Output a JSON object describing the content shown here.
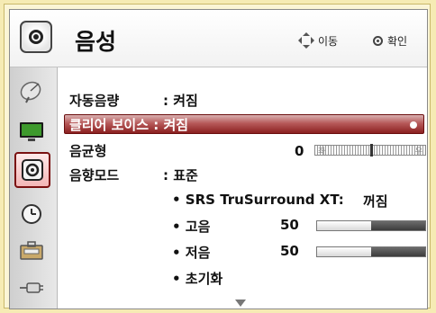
{
  "header": {
    "title": "음성",
    "move_label": "이동",
    "ok_label": "확인"
  },
  "sidebar": {
    "items": [
      {
        "icon": "satellite-dish-icon"
      },
      {
        "icon": "tv-screen-icon"
      },
      {
        "icon": "speaker-icon",
        "active": true
      },
      {
        "icon": "clock-icon"
      },
      {
        "icon": "toolbox-icon"
      },
      {
        "icon": "cable-plug-icon"
      }
    ]
  },
  "menu": {
    "auto_volume": {
      "label": "자동음량",
      "value": ": 켜짐"
    },
    "clear_voice": {
      "label": "클리어 보이스 : 켜짐"
    },
    "balance": {
      "label": "음균형",
      "value": "0",
      "left_cap": "좌",
      "right_cap": "우",
      "position": 0
    },
    "sound_mode": {
      "label": "음향모드",
      "value": ": 표준"
    },
    "srs": {
      "label": "• SRS TruSurround XT:",
      "value": "꺼짐"
    },
    "treble": {
      "label": "• 고음",
      "value": "50",
      "level": 0.5
    },
    "bass": {
      "label": "• 저음",
      "value": "50",
      "level": 0.5
    },
    "reset": {
      "label": "• 초기화"
    }
  },
  "colors": {
    "highlight": "#8b2020",
    "background": "#f6ebb4"
  }
}
